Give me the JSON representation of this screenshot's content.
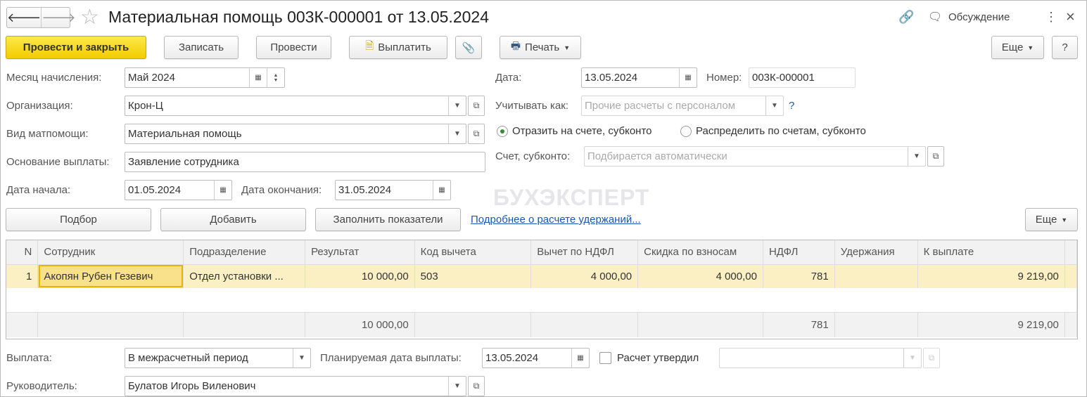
{
  "title": "Материальная помощь 003К-000001 от 13.05.2024",
  "header": {
    "discuss": "Обсуждение",
    "more": "⋮",
    "close": "×"
  },
  "toolbar": {
    "post_close": "Провести и закрыть",
    "save": "Записать",
    "post": "Провести",
    "pay": "Выплатить",
    "print": "Печать",
    "more": "Еще",
    "help": "?"
  },
  "form": {
    "month_label": "Месяц начисления:",
    "month": "Май 2024",
    "org_label": "Организация:",
    "org": "Крон-Ц",
    "type_label": "Вид матпомощи:",
    "type": "Материальная помощь",
    "basis_label": "Основание выплаты:",
    "basis": "Заявление сотрудника",
    "start_label": "Дата начала:",
    "start": "01.05.2024",
    "end_label": "Дата окончания:",
    "end": "31.05.2024",
    "date_label": "Дата:",
    "date": "13.05.2024",
    "number_label": "Номер:",
    "number": "003К-000001",
    "account_as_label": "Учитывать как:",
    "account_as": "Прочие расчеты с персоналом",
    "q": "?",
    "radio1": "Отразить на счете, субконто",
    "radio2": "Распределить по счетам, субконто",
    "account_label": "Счет, субконто:",
    "account": "Подбирается автоматически"
  },
  "tablebar": {
    "pick": "Подбор",
    "add": "Добавить",
    "fill": "Заполнить показатели",
    "link": "Подробнее о расчете удержаний...",
    "more": "Еще"
  },
  "table": {
    "columns": [
      "N",
      "Сотрудник",
      "Подразделение",
      "Результат",
      "Код вычета",
      "Вычет по НДФЛ",
      "Скидка по взносам",
      "НДФЛ",
      "Удержания",
      "К выплате"
    ],
    "rows": [
      [
        "1",
        "Акопян Рубен Гезевич",
        "Отдел установки ...",
        "10 000,00",
        "503",
        "4 000,00",
        "4 000,00",
        "781",
        "",
        "9 219,00"
      ]
    ],
    "totals": [
      "",
      "",
      "",
      "10 000,00",
      "",
      "",
      "",
      "781",
      "",
      "9 219,00"
    ]
  },
  "bottom": {
    "pay_label": "Выплата:",
    "pay": "В межрасчетный период",
    "plan_label": "Планируемая дата выплаты:",
    "plan": "13.05.2024",
    "approved": "Расчет утвердил",
    "head_label": "Руководитель:",
    "head": "Булатов Игорь Виленович"
  },
  "watermark": "БУХЭКСПЕРТ"
}
